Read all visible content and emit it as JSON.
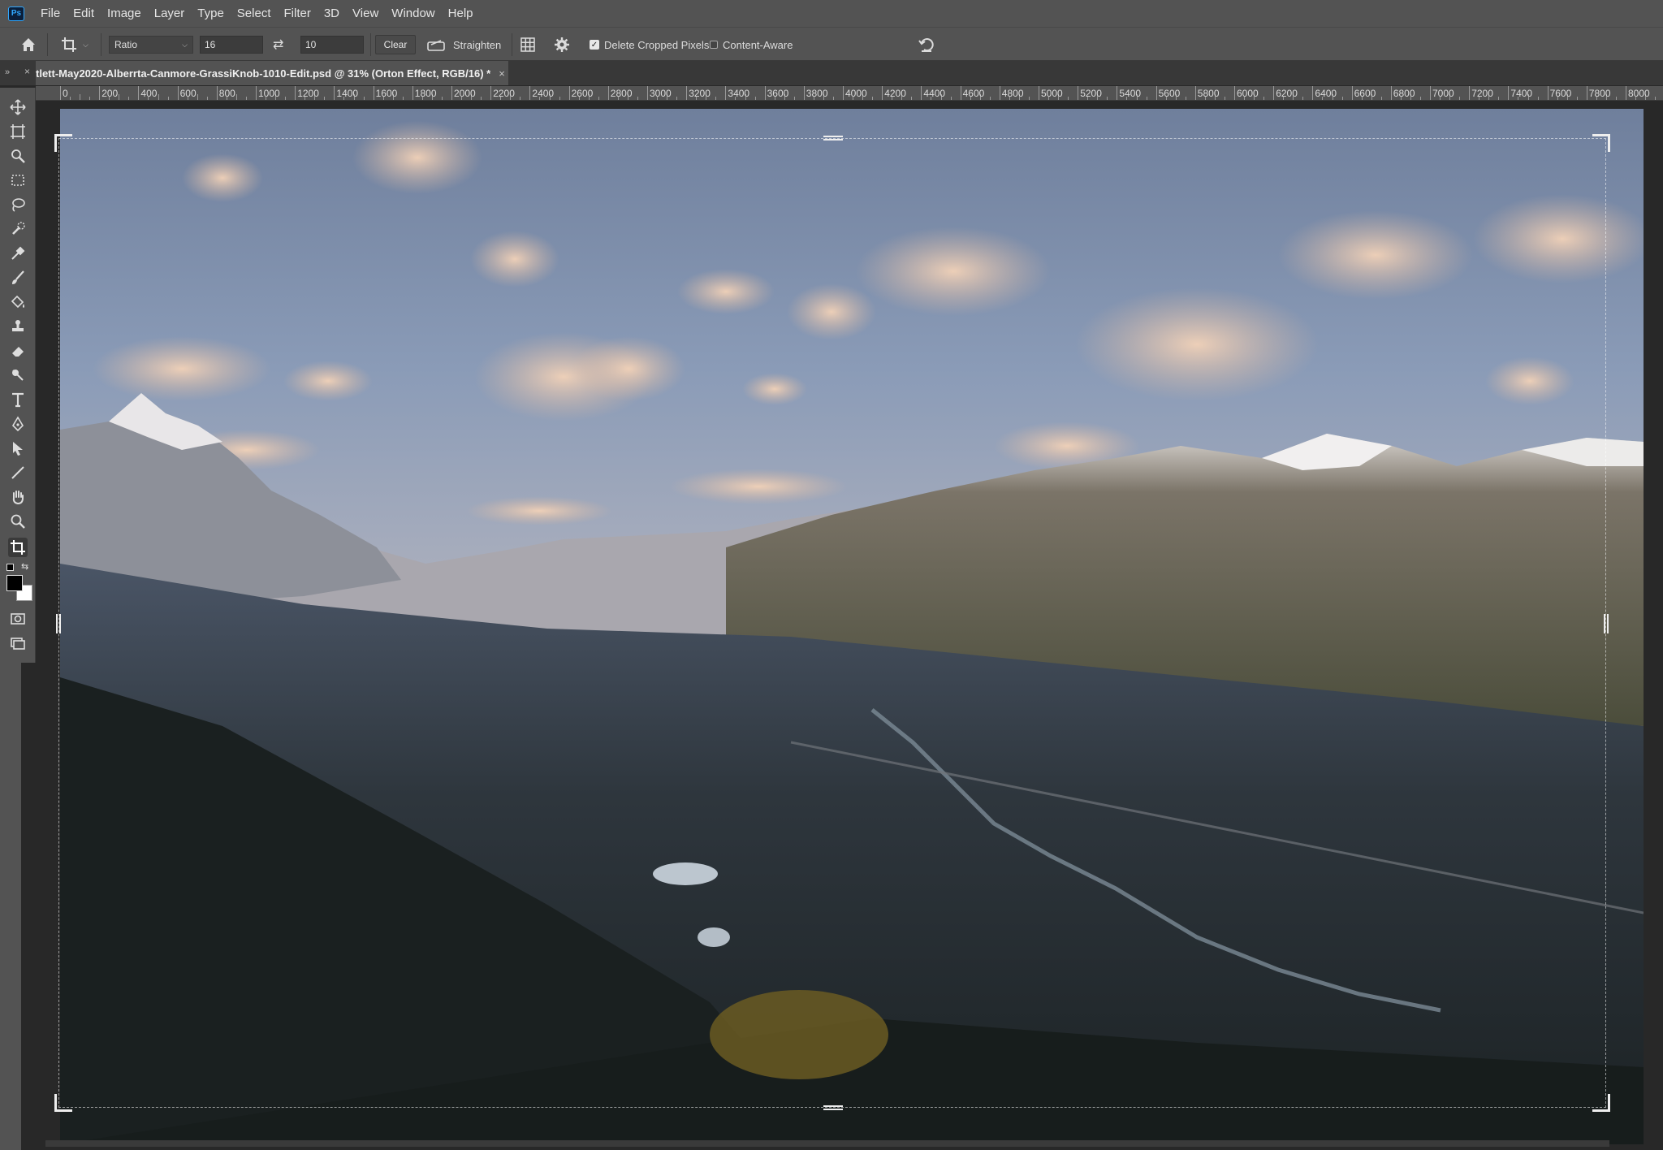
{
  "app": {
    "logo": "Ps"
  },
  "menu": [
    "File",
    "Edit",
    "Image",
    "Layer",
    "Type",
    "Select",
    "Filter",
    "3D",
    "View",
    "Window",
    "Help"
  ],
  "options": {
    "ratio_label": "Ratio",
    "width_value": "16",
    "height_value": "10",
    "clear_label": "Clear",
    "straighten_label": "Straighten",
    "delete_cropped_label": "Delete Cropped Pixels",
    "delete_cropped_checked": true,
    "content_aware_label": "Content-Aware",
    "content_aware_checked": false
  },
  "tabs": {
    "panel_collapse": "»",
    "panel_close": "×",
    "doc_title": "tlett-May2020-Alberrta-Canmore-GrassiKnob-1010-Edit.psd @ 31% (Orton Effect, RGB/16) *",
    "doc_close": "×"
  },
  "ruler": {
    "h_labels": [
      "0",
      "200",
      "400",
      "600",
      "800",
      "1000",
      "1200",
      "1400",
      "1600",
      "1800",
      "2000",
      "2200",
      "2400",
      "2600",
      "2800",
      "3000",
      "3200",
      "3400",
      "3600",
      "3800",
      "4000",
      "4200",
      "4400",
      "4600",
      "4800",
      "5000",
      "5200",
      "5400",
      "5600",
      "5800",
      "6000",
      "6200",
      "6400",
      "6600",
      "6800",
      "7000",
      "7200",
      "7400",
      "7600",
      "7800",
      "8000"
    ]
  },
  "tools": [
    "move-icon",
    "artboard-icon",
    "object-select-icon",
    "marquee-icon",
    "lasso-icon",
    "quick-select-icon",
    "eyedropper-icon",
    "brush-icon",
    "paint-bucket-icon",
    "stamp-icon",
    "eraser-icon",
    "dodge-icon",
    "type-icon",
    "pen-icon",
    "path-select-icon",
    "line-icon",
    "hand-icon",
    "zoom-icon",
    "crop-icon"
  ],
  "colors": {
    "foreground": "#000000",
    "background": "#ffffff",
    "accent": "#31a8ff"
  }
}
